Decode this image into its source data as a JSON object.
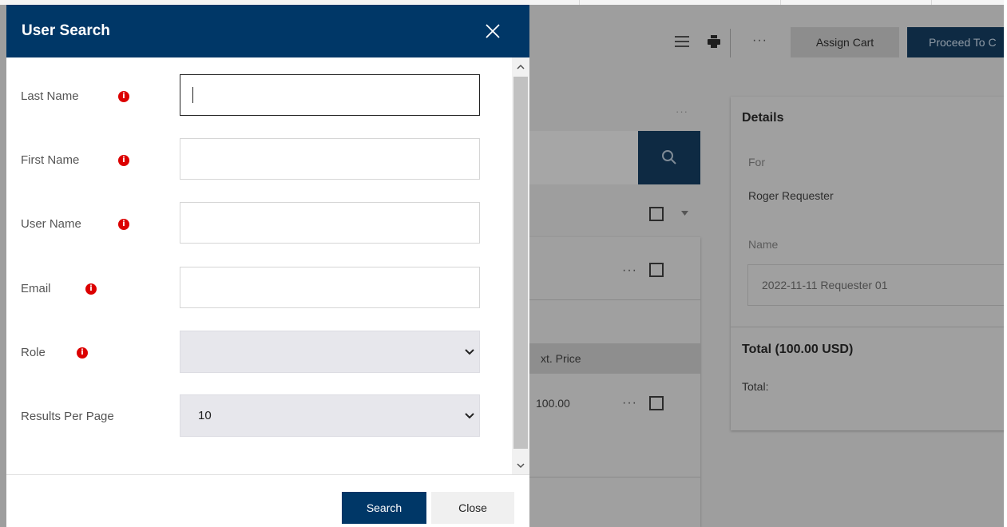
{
  "modal": {
    "title": "User Search",
    "fields": [
      {
        "label": "Last Name",
        "value": "",
        "has_info": true
      },
      {
        "label": "First Name",
        "value": "",
        "has_info": true
      },
      {
        "label": "User Name",
        "value": "",
        "has_info": true
      },
      {
        "label": "Email",
        "value": "",
        "has_info": true
      },
      {
        "label": "Role",
        "value": "",
        "has_info": true
      },
      {
        "label": "Results Per Page",
        "value": "10",
        "has_info": false
      }
    ],
    "info_glyph": "i",
    "search_label": "Search",
    "close_label": "Close",
    "header_color": "#003767",
    "info_color": "#dc0000"
  },
  "background": {
    "more_label": "···",
    "assign_cart_label": "Assign Cart",
    "proceed_label": "Proceed To C",
    "details": {
      "heading": "Details",
      "for_label": "For",
      "for_value": "Roger Requester",
      "name_label": "Name",
      "name_value": "2022-11-11 Requester 01",
      "total_heading": "Total (100.00 USD)",
      "total_label": "Total:"
    },
    "table": {
      "ext_price_header": "xt. Price",
      "row_price": "100.00"
    }
  }
}
